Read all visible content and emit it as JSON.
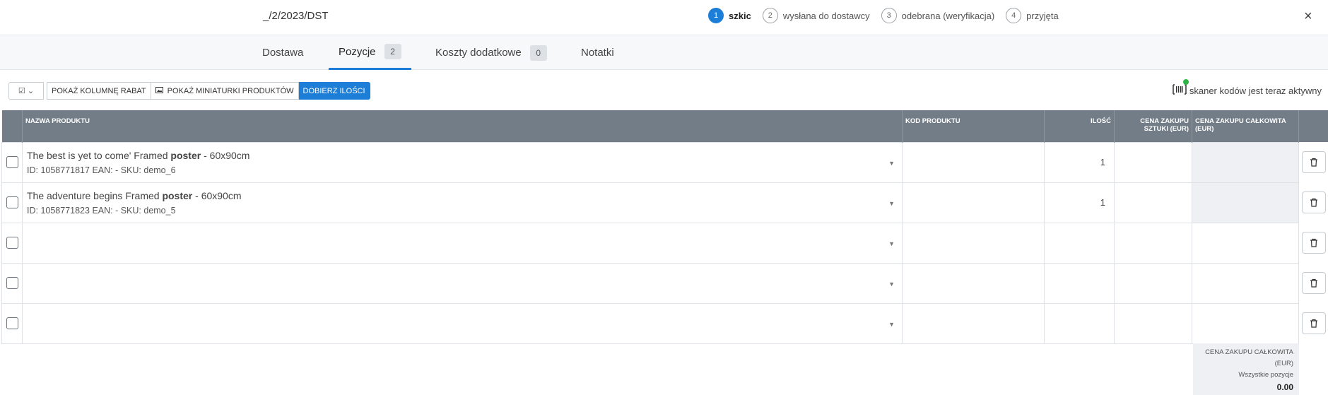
{
  "header": {
    "doc_number": "_/2/2023/DST",
    "steps": [
      {
        "num": "1",
        "label": "szkic",
        "active": true
      },
      {
        "num": "2",
        "label": "wysłana do dostawcy",
        "active": false
      },
      {
        "num": "3",
        "label": "odebrana (weryfikacja)",
        "active": false
      },
      {
        "num": "4",
        "label": "przyjęta",
        "active": false
      }
    ],
    "close_icon": "×"
  },
  "tabs": [
    {
      "label": "Dostawa"
    },
    {
      "label": "Pozycje",
      "badge": "2",
      "active": true
    },
    {
      "label": "Koszty dodatkowe",
      "badge": "0"
    },
    {
      "label": "Notatki"
    }
  ],
  "toolbar": {
    "select_icon": "☑ ⌄",
    "show_discount": "POKAŻ KOLUMNĘ RABAT",
    "show_thumbnails": "POKAŻ MINIATURKI PRODUKTÓW",
    "pick_quantities": "DOBIERZ ILOŚCI",
    "scanner_text": "skaner kodów jest teraz aktywny"
  },
  "table": {
    "columns": {
      "name": "NAZWA PRODUKTU",
      "code": "KOD PRODUKTU",
      "qty": "ILOŚĆ",
      "unit_price": "CENA ZAKUPU SZTUKI (EUR)",
      "total_price": "CENA ZAKUPU CAŁKOWITA (EUR)"
    },
    "rows": [
      {
        "title_pre": "The best is yet to come' Framed ",
        "title_bold": "poster",
        "title_post": " - 60x90cm",
        "sub": "ID: 1058771817 EAN: - SKU: demo_6",
        "qty": "1"
      },
      {
        "title_pre": "The adventure begins Framed ",
        "title_bold": "poster",
        "title_post": " - 60x90cm",
        "sub": "ID: 1058771823 EAN: - SKU: demo_5",
        "qty": "1"
      }
    ]
  },
  "summary": {
    "label": "CENA ZAKUPU CAŁKOWITA",
    "currency": "(EUR)",
    "scope": "Wszystkie pozycje",
    "value": "0.00"
  },
  "colors": {
    "accent": "#1c7ed6",
    "table_header": "#737d87",
    "scanner_active": "#2fb344"
  }
}
